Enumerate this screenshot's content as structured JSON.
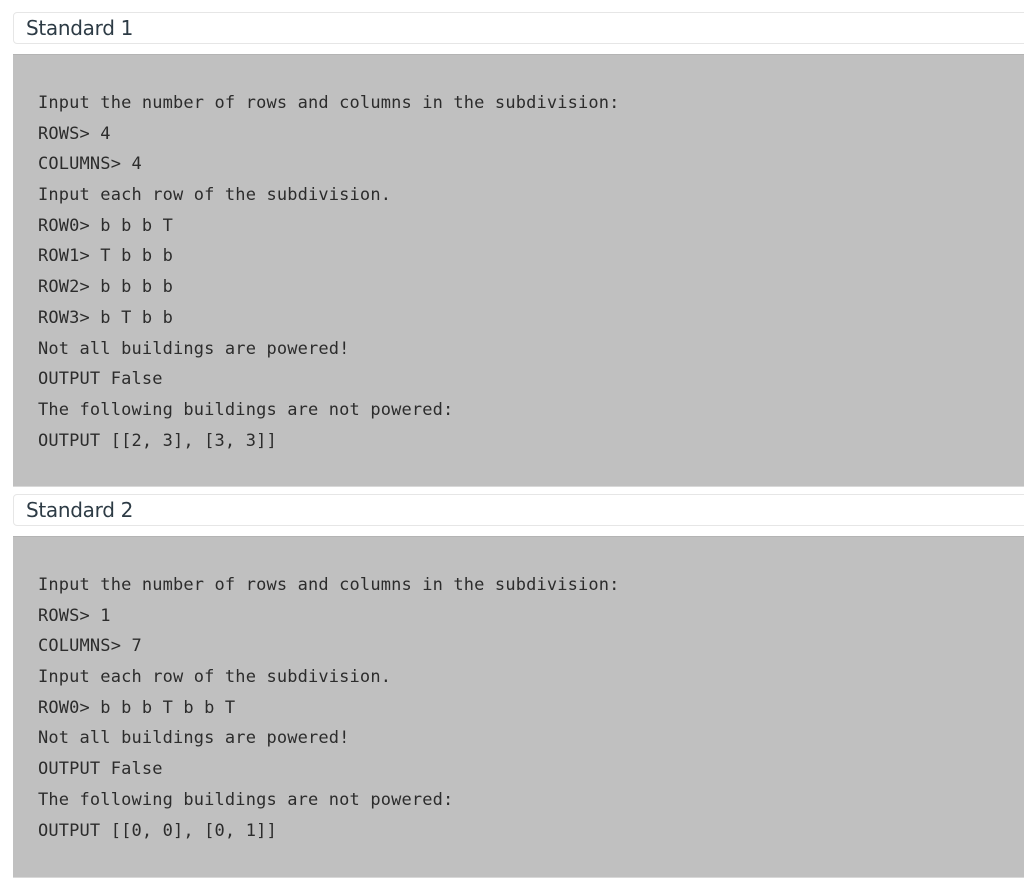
{
  "sections": [
    {
      "title": "Standard 1",
      "lines": [
        "Input the number of rows and columns in the subdivision:",
        "ROWS> 4",
        "COLUMNS> 4",
        "Input each row of the subdivision.",
        "ROW0> b b b T",
        "ROW1> T b b b",
        "ROW2> b b b b",
        "ROW3> b T b b",
        "Not all buildings are powered!",
        "OUTPUT False",
        "The following buildings are not powered:",
        "OUTPUT [[2, 3], [3, 3]]"
      ]
    },
    {
      "title": "Standard 2",
      "lines": [
        "Input the number of rows and columns in the subdivision:",
        "ROWS> 1",
        "COLUMNS> 7",
        "Input each row of the subdivision.",
        "ROW0> b b b T b b T",
        "Not all buildings are powered!",
        "OUTPUT False",
        "The following buildings are not powered:",
        "OUTPUT [[0, 0], [0, 1]]"
      ]
    }
  ]
}
